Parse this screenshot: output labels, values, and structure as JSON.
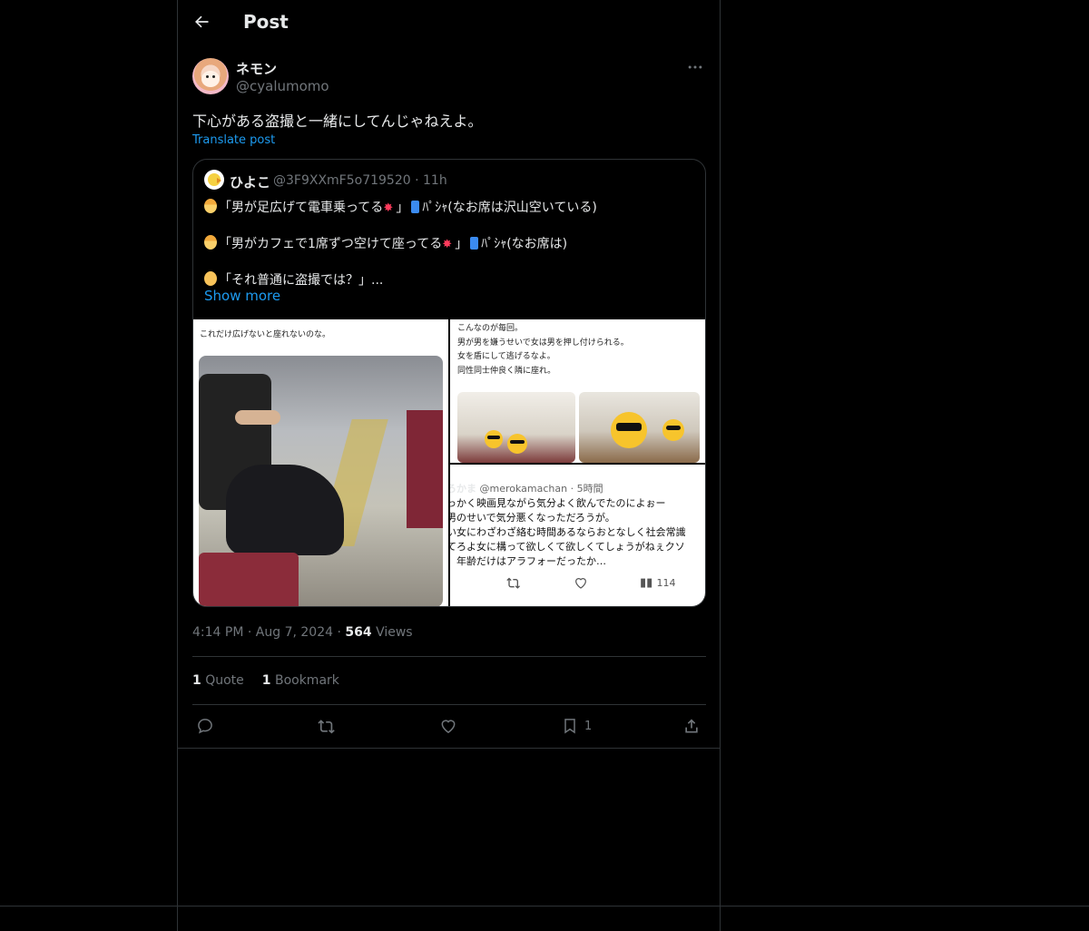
{
  "header": {
    "title": "Post"
  },
  "post": {
    "name": "ネモン",
    "handle": "@cyalumomo",
    "text": "下心がある盗撮と一緒にしてんじゃねえよ。",
    "translate": "Translate post",
    "time": "4:14 PM",
    "date": "Aug 7, 2024",
    "views_count": "564",
    "views_label": "Views",
    "quote_count": "1",
    "quote_label": "Quote",
    "bookmark_count": "1",
    "bookmark_label": "Bookmark",
    "bookmark_action_count": "1"
  },
  "quoted": {
    "name": "ひよこ",
    "handle": "@3F9XXmF5o719520",
    "time": "11h",
    "line1_a": "「男が足広げて電車乗ってる",
    "line1_b": "」",
    "line1_c": "ﾊﾟｼｬ(なお席は沢山空いている)",
    "line2_a": "「男がカフェで1席ずつ空けて座ってる",
    "line2_b": "」",
    "line2_c": "ﾊﾟｼｬ(なお席は)",
    "line3": "「それ普通に盗撮では？」...",
    "show_more": "Show more"
  },
  "images": {
    "left_caption": "これだけ広げないと座れないのな。",
    "right_top_caption": [
      "こんなのが毎回。",
      "男が男を嫌うせいで女は男を押し付けられる。",
      "女を盾にして逃げるなよ。",
      "同性同士仲良く隣に座れ。"
    ],
    "rb_name": "ろかま",
    "rb_handle": "@merokamachan · 5時間",
    "rb_lines": [
      "っかく映画見ながら気分よく飲んでたのによぉー",
      "男のせいで気分悪くなっただろうが。",
      "い女にわざわざ絡む時間あるならおとなしく社会常識",
      "てろよ女に構って欲しくて欲しくてしょうがねぇクソ",
      "、年齢だけはアラフォーだったか…"
    ],
    "rb_views": "114"
  },
  "colors": {
    "accent": "#1d9bf0",
    "text": "#e7e9ea",
    "muted": "#71767b",
    "border": "#2f3336"
  }
}
